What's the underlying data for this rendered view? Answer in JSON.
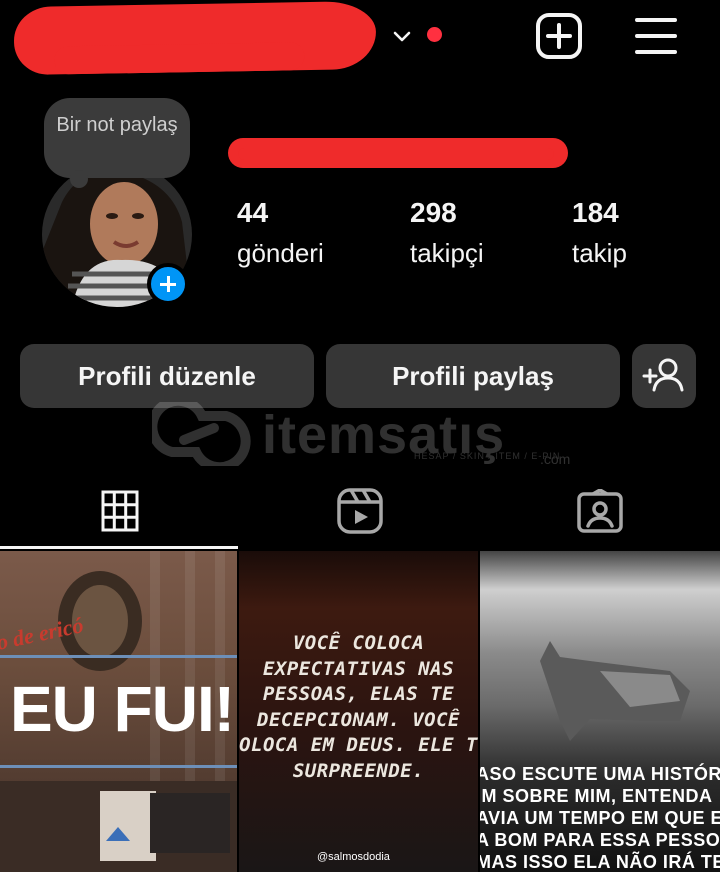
{
  "header": {
    "account_switch_icon": "chevron-down-icon",
    "notification_dot_color": "#ff3040",
    "create_icon": "plus-square-icon",
    "menu_icon": "hamburger-menu-icon"
  },
  "profile": {
    "note_bubble": "Bir not paylaş",
    "stats": [
      {
        "count": "44",
        "label": "gönderi"
      },
      {
        "count": "298",
        "label": "takipçi"
      },
      {
        "count": "184",
        "label": "takip"
      }
    ]
  },
  "actions": {
    "edit_profile": "Profili düzenle",
    "share_profile": "Profili paylaş",
    "discover_people_icon": "add-person-icon"
  },
  "watermark": {
    "text": "itemsatış",
    "subtext": "HESAP / SKIN / ITEM / E-PIN",
    "domain": ".com"
  },
  "tabs": [
    {
      "icon": "grid-icon",
      "active": true
    },
    {
      "icon": "reels-icon",
      "active": false
    },
    {
      "icon": "tagged-icon",
      "active": false
    }
  ],
  "posts": [
    {
      "script_text": "o de ericó",
      "main_text": "EU FUI!"
    },
    {
      "quote_lines": [
        "VOCÊ COLOCA",
        "EXPECTATIVAS NAS",
        "PESSOAS, ELAS TE",
        "DECEPCIONAM. VOCÊ",
        "OLOCA EM DEUS. ELE T",
        "SURPREENDE."
      ],
      "handle": "@salmosdodia"
    },
    {
      "quote_lines": [
        "ASO ESCUTE UMA HISTÓRI",
        "IM SOBRE MIM, ENTENDA",
        "AVIA UM TEMPO EM QUE E",
        "A BOM PARA ESSA PESSOA",
        "MAS ISSO ELA NÃO IRÁ TE"
      ]
    }
  ],
  "colors": {
    "accent_blue": "#0095f6",
    "button_bg": "#363636",
    "redaction": "#ef2b2b"
  }
}
